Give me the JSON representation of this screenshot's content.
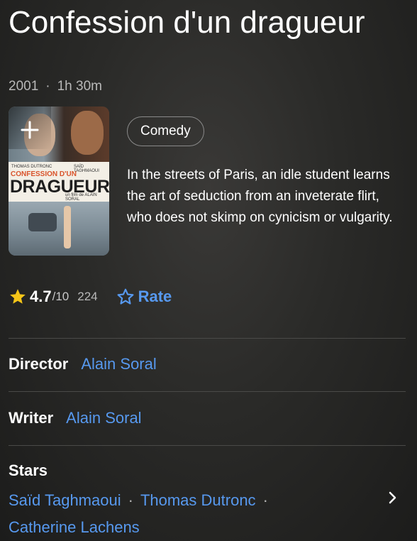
{
  "title": "Confession d'un dragueur",
  "meta": {
    "year": "2001",
    "runtime": "1h 30m",
    "separator": "·"
  },
  "poster": {
    "top_left_credit": "THOMAS DUTRONC",
    "top_right_credit": "SAÏD TAGHMAOUI",
    "title_line1": "CONFESSION D'UN",
    "title_line2": "DRAGUEUR",
    "byline": "un film de ALAIN SORAL",
    "add_icon": "plus-icon"
  },
  "genre": "Comedy",
  "plot": "In the streets of Paris, an idle student learns the art of seduction from an inveterate flirt, who does not skimp on cynicism or vulgarity.",
  "rating": {
    "value": "4.7",
    "max": "/10",
    "count": "224",
    "star_icon": "star-filled-icon",
    "star_color": "#f5c518"
  },
  "rate": {
    "label": "Rate",
    "icon": "star-outline-icon",
    "color": "#5799ef"
  },
  "director": {
    "label": "Director",
    "name": "Alain Soral"
  },
  "writer": {
    "label": "Writer",
    "name": "Alain Soral"
  },
  "stars": {
    "label": "Stars",
    "names": [
      "Saïd Taghmaoui",
      "Thomas Dutronc",
      "Catherine Lachens"
    ],
    "separator": "·",
    "chevron_icon": "chevron-right-icon"
  },
  "colors": {
    "link": "#5799ef",
    "accent_star": "#f5c518",
    "background": "#2a2a28"
  }
}
